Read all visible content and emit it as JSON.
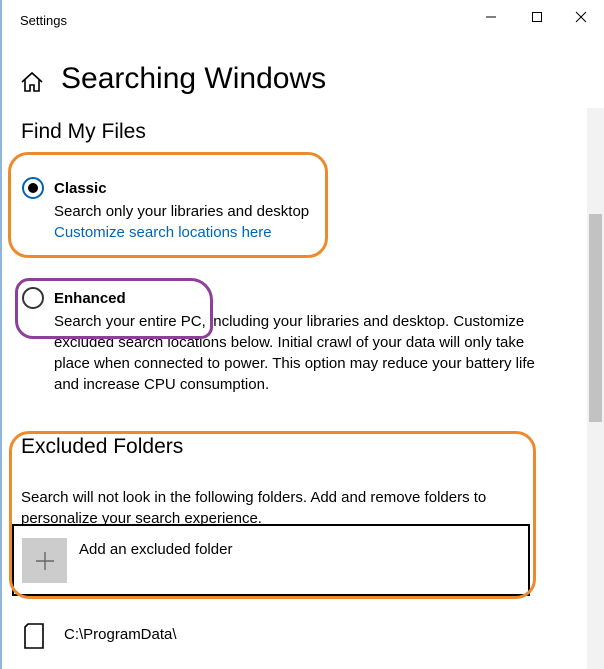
{
  "window": {
    "title": "Settings",
    "controls": [
      "minimize",
      "maximize",
      "close"
    ]
  },
  "header": {
    "title": "Searching Windows",
    "home_icon": "home-icon"
  },
  "find_my_files": {
    "title": "Find My Files",
    "classic": {
      "label": "Classic",
      "description": "Search only your libraries and desktop",
      "link": "Customize search locations here",
      "selected": true
    },
    "enhanced": {
      "label": "Enhanced",
      "description": "Search your entire PC, including your libraries and desktop. Customize excluded search locations below. Initial crawl of your data will only take place when connected to power. This option may reduce your battery life and increase CPU consumption.",
      "selected": false
    }
  },
  "excluded_folders": {
    "title": "Excluded Folders",
    "description": "Search will not look in the following folders. Add and remove folders to personalize your search experience.",
    "add_label": "Add an excluded folder",
    "folders": [
      "C:\\ProgramData\\"
    ]
  },
  "colors": {
    "accent": "#0063b1",
    "link": "#0066b4",
    "annotation_orange": "#ed8a2c",
    "annotation_purple": "#8e3f9a"
  }
}
